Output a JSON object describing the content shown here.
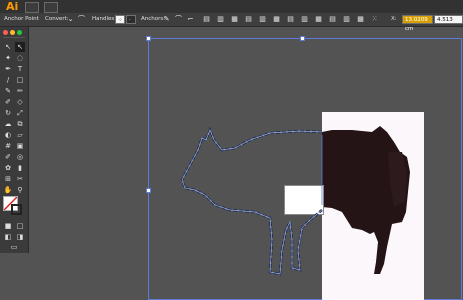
{
  "app": {
    "logo": "Ai"
  },
  "control_bar": {
    "label": "Anchor Point",
    "convert_label": "Convert:",
    "handles_label": "Handles:",
    "anchors_label": "Anchors:",
    "x_label": "X:",
    "x_value": "13.0209 cm",
    "y_value": "4.513"
  },
  "colors": {
    "accent": "#d7a000",
    "selection": "#5d7bd6",
    "logo": "#ff9a00"
  },
  "icons": [
    "menu-icon",
    "workspace-icon",
    "convert-corner-icon",
    "convert-smooth-icon",
    "handle-show-icon",
    "handle-hide-icon",
    "anchor-remove-icon",
    "anchor-cut-icon",
    "select-icon",
    "direct-select-icon",
    "pen-icon",
    "type-icon",
    "line-icon",
    "rectangle-icon",
    "brush-icon",
    "pencil-icon",
    "eraser-icon",
    "rotate-icon",
    "scale-icon",
    "warp-icon",
    "free-transform-icon",
    "shape-builder-icon",
    "perspective-icon",
    "mesh-icon",
    "gradient-icon",
    "eyedropper-icon",
    "blend-icon",
    "symbol-icon",
    "graph-icon",
    "artboard-icon",
    "slice-icon",
    "hand-icon",
    "zoom-icon",
    "fill-swatch-icon",
    "stroke-swatch-icon",
    "draw-mode-icon",
    "screen-mode-icon"
  ]
}
